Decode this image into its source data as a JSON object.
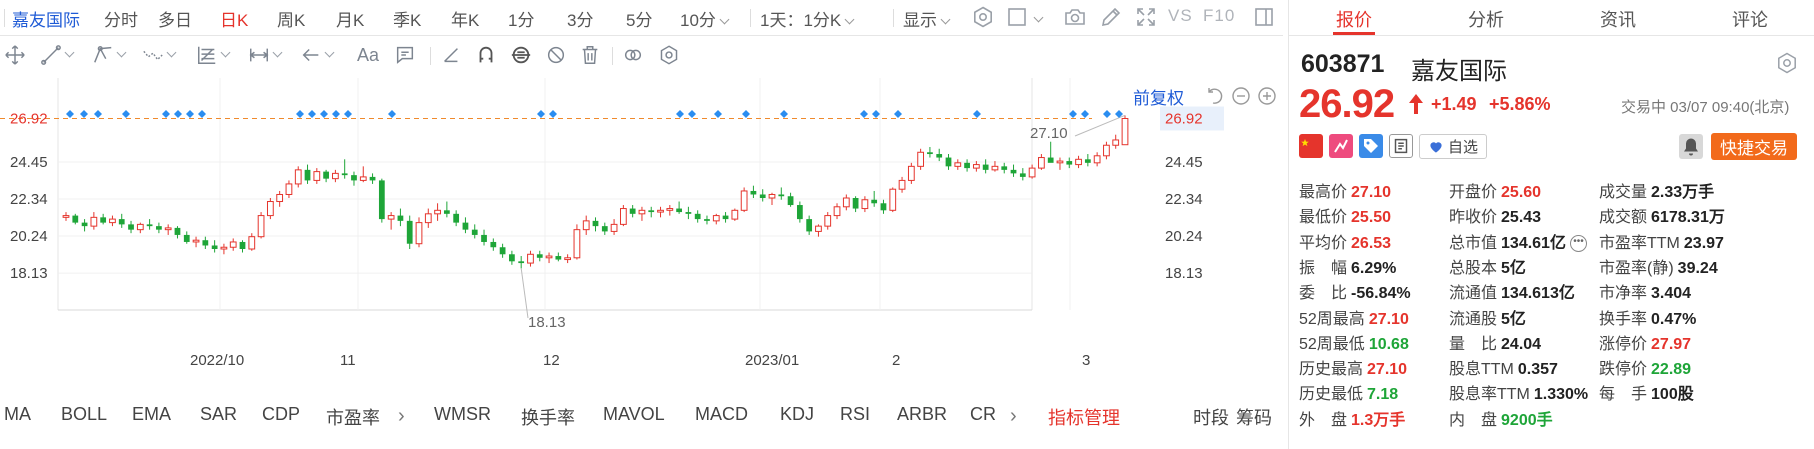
{
  "toolbar": {
    "stock_name": "嘉友国际",
    "periods": [
      "分时",
      "多日",
      "日K",
      "周K",
      "月K",
      "季K",
      "年K",
      "1分",
      "3分",
      "5分",
      "10分"
    ],
    "active_period": "日K",
    "interval_select": "1天：1分K",
    "display_label": "显示",
    "vs_label": "VS",
    "f10_label": "F10"
  },
  "draw_tools": {
    "text_tool_label": "Aa"
  },
  "chart": {
    "adjust_label": "前复权",
    "price_ticks": [
      "26.92",
      "24.45",
      "22.34",
      "20.24",
      "18.13"
    ],
    "current_price_left": "26.92",
    "current_price_right": "26.92",
    "high_annotation": "27.10",
    "low_annotation": "18.13",
    "x_ticks": [
      "2022/10",
      "11",
      "12",
      "2023/01",
      "2",
      "3"
    ]
  },
  "chart_data": {
    "type": "candlestick",
    "y_axis_ticks": [
      26.92,
      24.45,
      22.34,
      20.24,
      18.13
    ],
    "ylim": [
      16.6,
      28.2
    ],
    "x_axis_ticks": [
      "2022/10",
      "11",
      "12",
      "2023/01",
      "2",
      "3"
    ],
    "last_price": 26.92,
    "annotations": [
      {
        "label": "27.10",
        "type": "period-high"
      },
      {
        "label": "18.13",
        "type": "period-low"
      }
    ],
    "up_color": "#e5342c",
    "down_color": "#1ea538",
    "bars_ohlc": [
      [
        21.3,
        21.6,
        21.1,
        21.4
      ],
      [
        21.4,
        21.5,
        20.9,
        21.0
      ],
      [
        21.0,
        21.2,
        20.5,
        20.8
      ],
      [
        20.8,
        21.6,
        20.6,
        21.3
      ],
      [
        21.3,
        21.5,
        20.9,
        21.0
      ],
      [
        21.0,
        21.4,
        20.8,
        21.2
      ],
      [
        21.2,
        21.5,
        20.7,
        20.9
      ],
      [
        20.9,
        21.1,
        20.4,
        20.6
      ],
      [
        20.6,
        21.0,
        20.4,
        20.9
      ],
      [
        20.9,
        21.2,
        20.6,
        20.8
      ],
      [
        20.8,
        21.0,
        20.4,
        20.6
      ],
      [
        20.6,
        20.9,
        20.3,
        20.7
      ],
      [
        20.7,
        20.8,
        20.1,
        20.3
      ],
      [
        20.3,
        20.5,
        19.8,
        19.9
      ],
      [
        19.9,
        20.2,
        19.6,
        20.0
      ],
      [
        20.0,
        20.2,
        19.5,
        19.7
      ],
      [
        19.7,
        20.0,
        19.3,
        19.5
      ],
      [
        19.5,
        19.8,
        19.2,
        19.6
      ],
      [
        19.6,
        20.1,
        19.4,
        19.9
      ],
      [
        19.9,
        20.0,
        19.3,
        19.5
      ],
      [
        19.5,
        20.4,
        19.4,
        20.2
      ],
      [
        20.2,
        21.6,
        20.1,
        21.4
      ],
      [
        21.4,
        22.4,
        21.2,
        22.2
      ],
      [
        22.2,
        22.8,
        21.9,
        22.6
      ],
      [
        22.6,
        23.4,
        22.4,
        23.2
      ],
      [
        23.2,
        24.2,
        23.0,
        24.0
      ],
      [
        24.0,
        24.3,
        23.2,
        23.4
      ],
      [
        23.4,
        24.1,
        23.2,
        23.9
      ],
      [
        23.9,
        24.0,
        23.3,
        23.5
      ],
      [
        23.5,
        24.0,
        23.3,
        23.8
      ],
      [
        23.8,
        24.6,
        23.5,
        23.7
      ],
      [
        23.7,
        23.9,
        23.1,
        23.4
      ],
      [
        23.4,
        24.2,
        23.3,
        23.6
      ],
      [
        23.6,
        23.8,
        23.2,
        23.4
      ],
      [
        23.4,
        23.5,
        21.0,
        21.2
      ],
      [
        21.2,
        21.6,
        20.6,
        21.4
      ],
      [
        21.4,
        21.8,
        20.8,
        21.1
      ],
      [
        21.1,
        21.4,
        19.5,
        19.8
      ],
      [
        19.8,
        21.3,
        19.6,
        21.0
      ],
      [
        21.0,
        21.8,
        20.7,
        21.5
      ],
      [
        21.5,
        22.1,
        21.1,
        21.7
      ],
      [
        21.7,
        22.2,
        21.3,
        21.5
      ],
      [
        21.5,
        21.7,
        20.8,
        21.0
      ],
      [
        21.0,
        21.3,
        20.4,
        20.6
      ],
      [
        20.6,
        20.9,
        20.1,
        20.3
      ],
      [
        20.3,
        20.6,
        19.7,
        19.9
      ],
      [
        19.9,
        20.1,
        19.4,
        19.6
      ],
      [
        19.6,
        19.8,
        19.0,
        19.2
      ],
      [
        19.2,
        19.4,
        18.6,
        18.8
      ],
      [
        18.8,
        19.1,
        18.4,
        18.7
      ],
      [
        18.7,
        19.4,
        18.5,
        19.2
      ],
      [
        19.2,
        19.4,
        18.8,
        19.0
      ],
      [
        19.0,
        19.3,
        18.7,
        19.1
      ],
      [
        19.1,
        19.3,
        18.8,
        18.9
      ],
      [
        18.9,
        19.2,
        18.7,
        19.0
      ],
      [
        19.0,
        20.9,
        18.9,
        20.6
      ],
      [
        20.6,
        21.4,
        20.3,
        21.1
      ],
      [
        21.1,
        21.3,
        20.5,
        20.8
      ],
      [
        20.8,
        21.0,
        20.3,
        20.5
      ],
      [
        20.5,
        21.2,
        20.3,
        20.9
      ],
      [
        20.9,
        22.0,
        20.8,
        21.8
      ],
      [
        21.8,
        22.0,
        21.3,
        21.5
      ],
      [
        21.5,
        21.9,
        21.1,
        21.7
      ],
      [
        21.7,
        21.9,
        21.3,
        21.6
      ],
      [
        21.6,
        21.9,
        21.3,
        21.7
      ],
      [
        21.7,
        22.0,
        21.4,
        21.8
      ],
      [
        21.8,
        22.2,
        21.5,
        21.6
      ],
      [
        21.6,
        21.9,
        21.2,
        21.5
      ],
      [
        21.5,
        21.7,
        21.0,
        21.2
      ],
      [
        21.2,
        21.4,
        20.9,
        21.1
      ],
      [
        21.1,
        21.5,
        20.9,
        21.4
      ],
      [
        21.4,
        21.6,
        21.0,
        21.2
      ],
      [
        21.2,
        21.8,
        21.1,
        21.7
      ],
      [
        21.7,
        23.0,
        21.6,
        22.8
      ],
      [
        22.8,
        23.1,
        22.4,
        22.6
      ],
      [
        22.6,
        22.9,
        22.2,
        22.4
      ],
      [
        22.4,
        22.7,
        22.0,
        22.6
      ],
      [
        22.6,
        23.0,
        22.3,
        22.5
      ],
      [
        22.5,
        22.7,
        21.9,
        22.0
      ],
      [
        22.0,
        22.2,
        21.0,
        21.2
      ],
      [
        21.2,
        21.4,
        20.3,
        20.5
      ],
      [
        20.5,
        20.9,
        20.2,
        20.8
      ],
      [
        20.8,
        21.6,
        20.6,
        21.4
      ],
      [
        21.4,
        22.1,
        21.2,
        21.9
      ],
      [
        21.9,
        22.6,
        21.7,
        22.4
      ],
      [
        22.4,
        22.5,
        21.6,
        21.8
      ],
      [
        21.8,
        22.5,
        21.6,
        22.3
      ],
      [
        22.3,
        22.8,
        21.9,
        22.1
      ],
      [
        22.1,
        22.3,
        21.5,
        21.7
      ],
      [
        21.7,
        23.0,
        21.6,
        22.9
      ],
      [
        22.9,
        23.6,
        22.7,
        23.4
      ],
      [
        23.4,
        24.4,
        23.2,
        24.2
      ],
      [
        24.2,
        25.2,
        24.0,
        25.0
      ],
      [
        25.0,
        25.3,
        24.7,
        24.9
      ],
      [
        24.9,
        25.2,
        24.5,
        24.7
      ],
      [
        24.7,
        24.9,
        24.0,
        24.2
      ],
      [
        24.2,
        24.6,
        24.0,
        24.4
      ],
      [
        24.4,
        24.6,
        23.9,
        24.1
      ],
      [
        24.1,
        24.5,
        23.9,
        24.3
      ],
      [
        24.3,
        24.6,
        23.8,
        24.0
      ],
      [
        24.0,
        24.5,
        23.9,
        24.2
      ],
      [
        24.2,
        24.4,
        23.8,
        24.0
      ],
      [
        24.0,
        24.3,
        23.6,
        23.8
      ],
      [
        23.8,
        24.1,
        23.4,
        23.6
      ],
      [
        23.6,
        24.3,
        23.5,
        24.1
      ],
      [
        24.1,
        24.9,
        24.0,
        24.7
      ],
      [
        24.7,
        25.6,
        24.5,
        24.4
      ],
      [
        24.4,
        24.7,
        24.0,
        24.5
      ],
      [
        24.5,
        24.7,
        24.1,
        24.3
      ],
      [
        24.3,
        24.8,
        24.1,
        24.6
      ],
      [
        24.6,
        24.9,
        24.2,
        24.4
      ],
      [
        24.4,
        25.0,
        24.2,
        24.8
      ],
      [
        24.8,
        25.6,
        24.6,
        25.4
      ],
      [
        25.4,
        26.0,
        25.2,
        25.7
      ],
      [
        25.43,
        27.1,
        25.5,
        26.92
      ]
    ]
  },
  "indicators": [
    "MA",
    "BOLL",
    "EMA",
    "SAR",
    "CDP",
    "市盈率",
    "WMSR",
    "换手率",
    "MAVOL",
    "MACD",
    "KDJ",
    "RSI",
    "ARBR",
    "CR"
  ],
  "indicator_manager": "指标管理",
  "bottom_right": [
    "时段",
    "筹码"
  ],
  "panel": {
    "tabs": [
      "报价",
      "分析",
      "资讯",
      "评论"
    ],
    "active_tab": "报价",
    "code": "603871",
    "name": "嘉友国际",
    "price": "26.92",
    "change": "+1.49",
    "change_pct": "+5.86%",
    "status": "交易中 03/07 09:40(北京)",
    "watch_label": "自选",
    "quick_trade_label": "快捷交易",
    "quotes": [
      {
        "label": "最高价",
        "value": "27.10",
        "color": "r"
      },
      {
        "label": "开盘价",
        "value": "25.60",
        "color": "r"
      },
      {
        "label": "成交量",
        "value": "2.33万手",
        "color": "k"
      },
      {
        "label": "最低价",
        "value": "25.50",
        "color": "r"
      },
      {
        "label": "昨收价",
        "value": "25.43",
        "color": "k"
      },
      {
        "label": "成交额",
        "value": "6178.31万",
        "color": "k"
      },
      {
        "label": "平均价",
        "value": "26.53",
        "color": "r"
      },
      {
        "label": "总市值",
        "value": "134.61亿",
        "color": "k"
      },
      {
        "label": "市盈率TTM",
        "value": "23.97",
        "color": "k"
      },
      {
        "label": "振　幅",
        "value": "6.29%",
        "color": "k"
      },
      {
        "label": "总股本",
        "value": "5亿",
        "color": "k"
      },
      {
        "label": "市盈率(静)",
        "value": "39.24",
        "color": "k"
      },
      {
        "label": "委　比",
        "value": "-56.84%",
        "color": "k"
      },
      {
        "label": "流通值",
        "value": "134.613亿",
        "color": "k"
      },
      {
        "label": "市净率",
        "value": "3.404",
        "color": "k"
      },
      {
        "label": "52周最高",
        "value": "27.10",
        "color": "r"
      },
      {
        "label": "流通股",
        "value": "5亿",
        "color": "k"
      },
      {
        "label": "换手率",
        "value": "0.47%",
        "color": "k"
      },
      {
        "label": "52周最低",
        "value": "10.68",
        "color": "g"
      },
      {
        "label": "量　比",
        "value": "24.04",
        "color": "k"
      },
      {
        "label": "涨停价",
        "value": "27.97",
        "color": "r"
      },
      {
        "label": "历史最高",
        "value": "27.10",
        "color": "r"
      },
      {
        "label": "股息TTM",
        "value": "0.357",
        "color": "k"
      },
      {
        "label": "跌停价",
        "value": "22.89",
        "color": "g"
      },
      {
        "label": "历史最低",
        "value": "7.18",
        "color": "g"
      },
      {
        "label": "股息率TTM",
        "value": "1.330%",
        "color": "k"
      },
      {
        "label": "每　手",
        "value": "100股",
        "color": "k"
      },
      {
        "label": "外　盘",
        "value": "1.3万手",
        "color": "r"
      },
      {
        "label": "内　盘",
        "value": "9200手",
        "color": "g"
      }
    ]
  }
}
